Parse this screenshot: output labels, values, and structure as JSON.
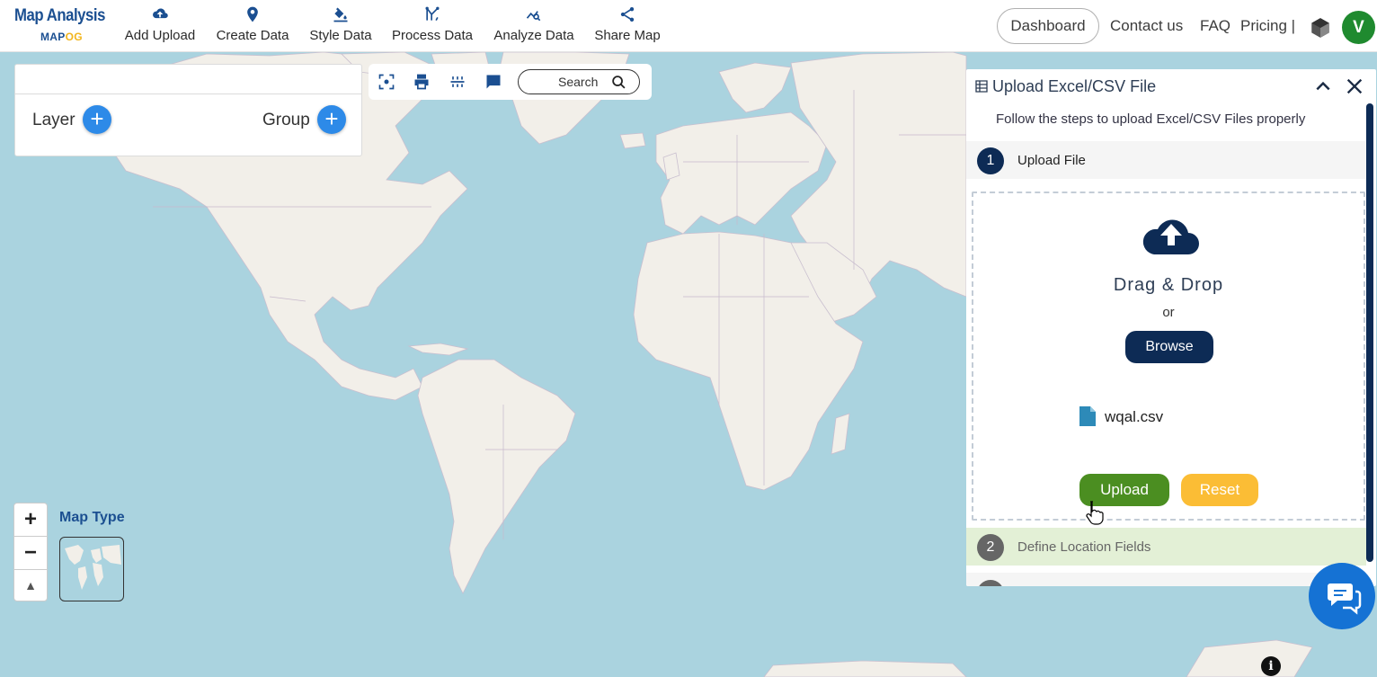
{
  "logo": {
    "line1": "Map Analysis",
    "line2_a": "MAP",
    "line2_b": "OG"
  },
  "nav": [
    {
      "label": "Add Upload",
      "icon": "cloud-upload-icon"
    },
    {
      "label": "Create Data",
      "icon": "map-pin-icon"
    },
    {
      "label": "Style Data",
      "icon": "paint-bucket-icon"
    },
    {
      "label": "Process Data",
      "icon": "process-icon"
    },
    {
      "label": "Analyze Data",
      "icon": "analyze-icon"
    },
    {
      "label": "Share Map",
      "icon": "share-icon"
    }
  ],
  "header_right": {
    "dashboard": "Dashboard",
    "contact": "Contact us",
    "faq": "FAQ",
    "pricing": "Pricing |",
    "avatar": "V"
  },
  "layer_panel": {
    "layer_label": "Layer",
    "group_label": "Group",
    "add": "+"
  },
  "map_tools": {
    "search_label": "Search"
  },
  "map_controls": {
    "zoom_in": "+",
    "zoom_out": "−",
    "reset": "▲",
    "map_type_label": "Map Type"
  },
  "upload_panel": {
    "title": "Upload Excel/CSV File",
    "subtitle": "Follow the steps to upload Excel/CSV Files properly",
    "step1_num": "1",
    "step1_label": "Upload File",
    "drag_drop": "Drag & Drop",
    "or": "or",
    "browse": "Browse",
    "file_name": "wqal.csv",
    "upload": "Upload",
    "reset": "Reset",
    "step2_num": "2",
    "step2_label": "Define Location Fields"
  },
  "colors": {
    "brand": "#1b4f91",
    "upload_green": "#4b8e21",
    "reset_yellow": "#fbbd35",
    "browse_navy": "#0d2b55",
    "add_blue": "#2d8ae8",
    "avatar_green": "#1f8a2f",
    "water": "#aad3df",
    "land": "#f2efe9"
  }
}
